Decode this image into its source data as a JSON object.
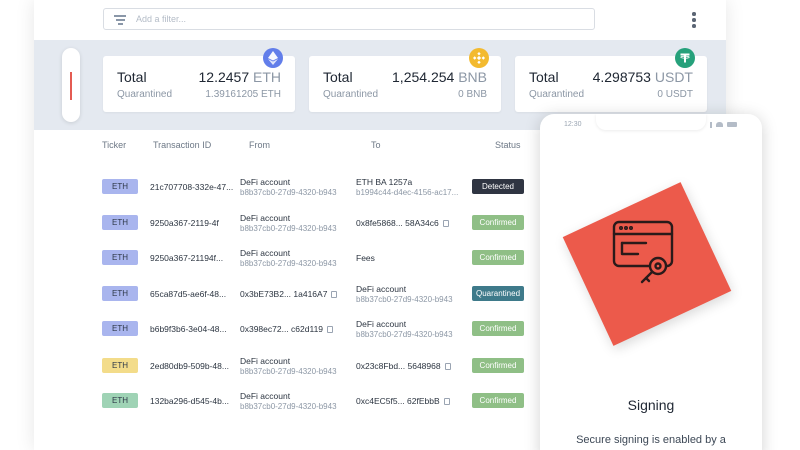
{
  "filter": {
    "placeholder": "Add a filter...",
    "menu_icon": "kebab-menu-icon",
    "filter_icon": "filter-lines-icon"
  },
  "balances": [
    {
      "total_label": "Total",
      "amount": "12.2457",
      "unit": "ETH",
      "quarantined_label": "Quarantined",
      "quarantined_amount": "1.39161205",
      "quarantined_unit": "ETH",
      "icon": "ethereum-icon",
      "icon_color": "#627eea"
    },
    {
      "total_label": "Total",
      "amount": "1,254.254",
      "unit": "BNB",
      "quarantined_label": "Quarantined",
      "quarantined_amount": "0",
      "quarantined_unit": "BNB",
      "icon": "binance-icon",
      "icon_color": "#f3ba2f"
    },
    {
      "total_label": "Total",
      "amount": "4.298753",
      "unit": "USDT",
      "quarantined_label": "Quarantined",
      "quarantined_amount": "0",
      "quarantined_unit": "USDT",
      "icon": "tether-icon",
      "icon_color": "#26a17b"
    }
  ],
  "table": {
    "headers": {
      "ticker": "Ticker",
      "txid": "Transaction ID",
      "from": "From",
      "to": "To",
      "status": "Status"
    },
    "rows": [
      {
        "ticker": "ETH",
        "ticker_color": "#a9b5ee",
        "txid": "21c707708-332e-47...",
        "from": {
          "line1": "DeFi account",
          "line2": "b8b37cb0-27d9-4320-b943"
        },
        "to": {
          "line1": "ETH BA 1257a",
          "line2": "b1994c44-d4ec-4156-ac17..."
        },
        "status": "Detected",
        "status_color": "#2f3542"
      },
      {
        "ticker": "ETH",
        "ticker_color": "#a9b5ee",
        "txid": "9250a367-2119-4f",
        "from": {
          "line1": "DeFi account",
          "line2": "b8b37cb0-27d9-4320-b943"
        },
        "to": {
          "single": "0x8fe5868... 58A34c6"
        },
        "status": "Confirmed",
        "status_color": "#8fbf86"
      },
      {
        "ticker": "ETH",
        "ticker_color": "#a9b5ee",
        "txid": "9250a367-21194f...",
        "from": {
          "line1": "DeFi account",
          "line2": "b8b37cb0-27d9-4320-b943"
        },
        "to": {
          "single": "Fees"
        },
        "status": "Confirmed",
        "status_color": "#8fbf86"
      },
      {
        "ticker": "ETH",
        "ticker_color": "#a9b5ee",
        "txid": "65ca87d5-ae6f-48...",
        "from": {
          "single": "0x3bE73B2... 1a416A7"
        },
        "to": {
          "line1": "DeFi account",
          "line2": "b8b37cb0-27d9-4320-b943"
        },
        "status": "Quarantined",
        "status_color": "#3e7a8a"
      },
      {
        "ticker": "ETH",
        "ticker_color": "#a9b5ee",
        "txid": "b6b9f3b6-3e04-48...",
        "from": {
          "single": "0x398ec72... c62d119"
        },
        "to": {
          "line1": "DeFi account",
          "line2": "b8b37cb0-27d9-4320-b943"
        },
        "status": "Confirmed",
        "status_color": "#8fbf86"
      },
      {
        "ticker": "ETH",
        "ticker_color": "#f3dc8a",
        "txid": "2ed80db9-509b-48...",
        "from": {
          "line1": "DeFi account",
          "line2": "b8b37cb0-27d9-4320-b943"
        },
        "to": {
          "single": "0x23c8Fbd... 5648968"
        },
        "status": "Confirmed",
        "status_color": "#8fbf86"
      },
      {
        "ticker": "ETH",
        "ticker_color": "#9fd3b5",
        "txid": "132ba296-d545-4b...",
        "from": {
          "line1": "DeFi account",
          "line2": "b8b37cb0-27d9-4320-b943"
        },
        "to": {
          "single": "0xc4EC5f5... 62fEbbB"
        },
        "status": "Confirmed",
        "status_color": "#8fbf86"
      }
    ]
  },
  "phone": {
    "time": "12:30",
    "title": "Signing",
    "description": "Secure signing is enabled by a",
    "card_color": "#ec5a4b",
    "illustration_icon": "signing-key-window-icon"
  }
}
